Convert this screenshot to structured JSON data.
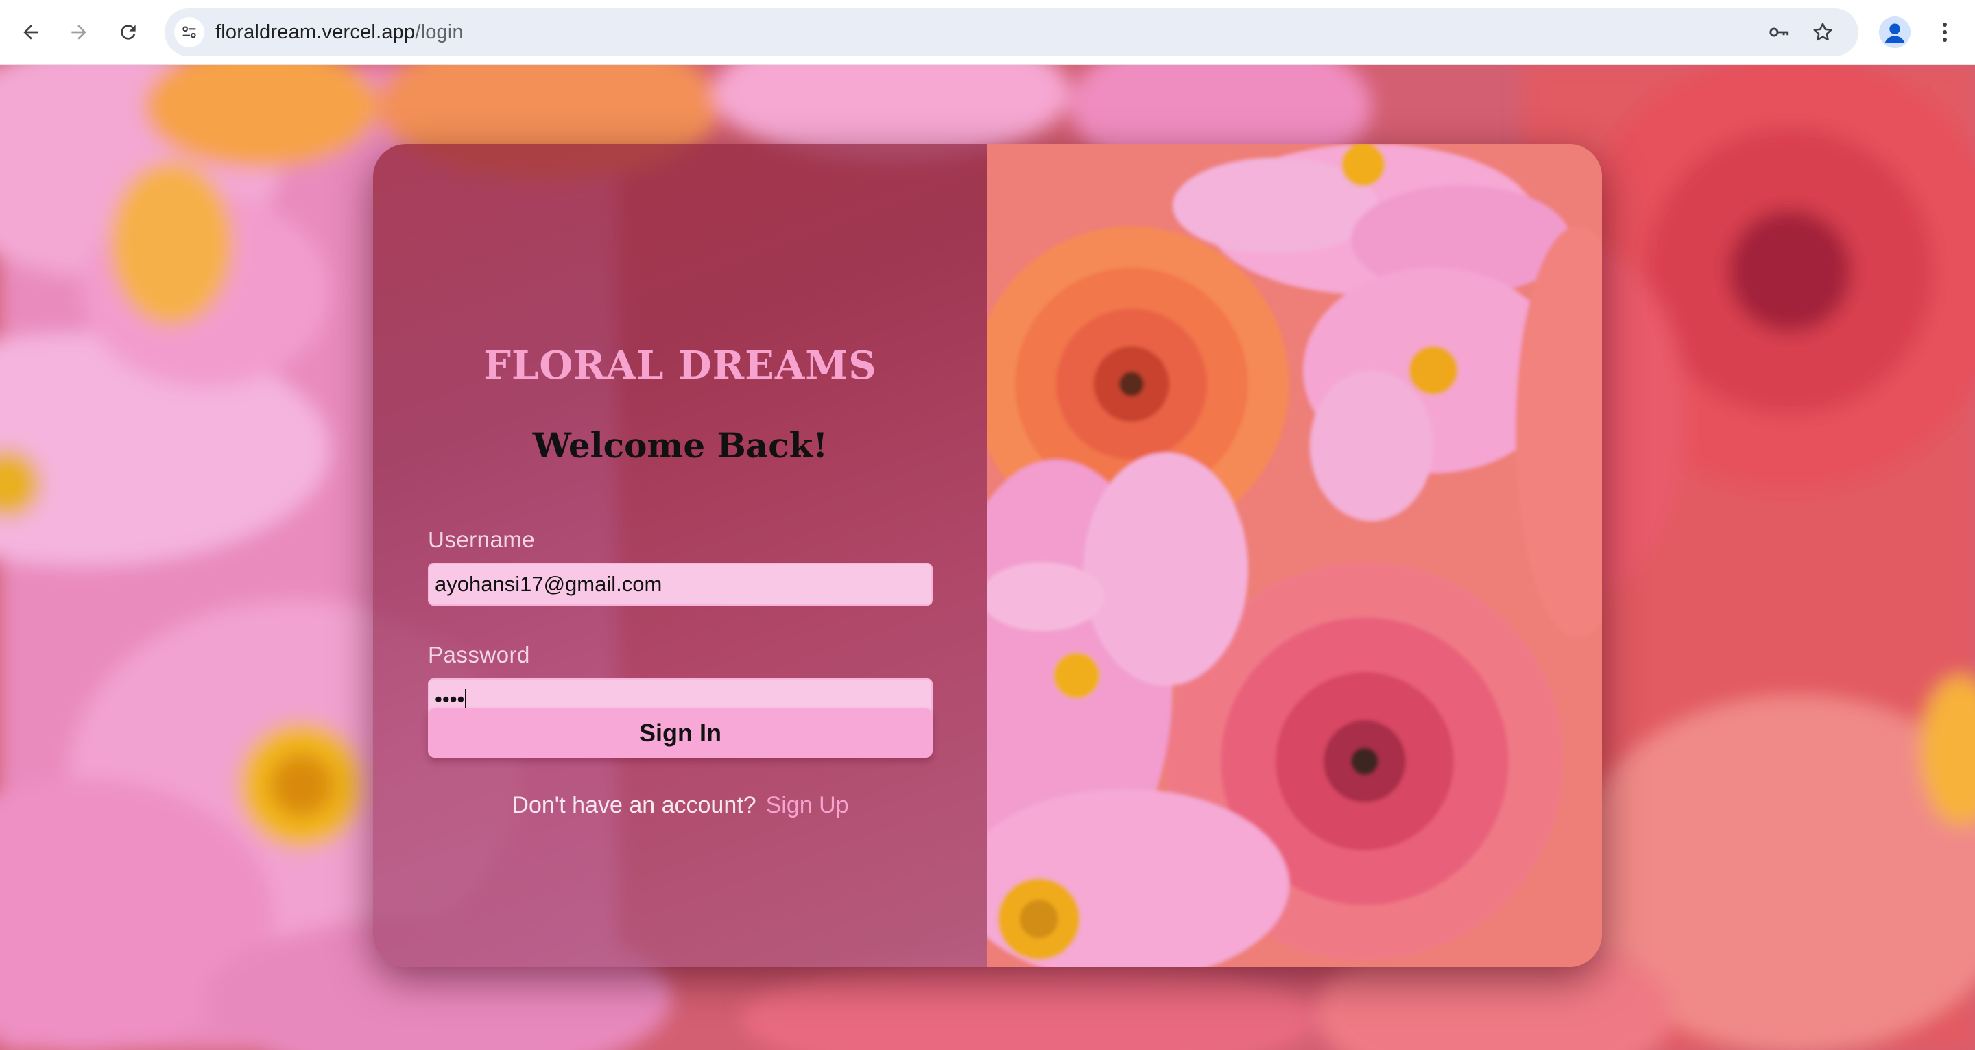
{
  "browser": {
    "url_host": "floraldream.vercel.app",
    "url_path": "/login",
    "buttons": {
      "back": "back-arrow-icon",
      "forward": "forward-arrow-icon",
      "reload": "reload-icon",
      "site_info": "tune-icon",
      "password_manager": "key-icon",
      "bookmark": "star-icon",
      "profile": "person-icon",
      "menu": "more-vert-icon"
    }
  },
  "login": {
    "brand": "FLORAL DREAMS",
    "heading": "Welcome Back!",
    "username_label": "Username",
    "username_value": "ayohansi17@gmail.com",
    "password_label": "Password",
    "password_masked": "••••",
    "signin_label": "Sign In",
    "no_account_text": "Don't have an account?",
    "signup_link": "Sign Up"
  },
  "colors": {
    "brand_pink": "#f7a3d0",
    "input_bg": "#f9c8e6",
    "button_bg": "#f8a8d6",
    "card_tint": "#8c2840"
  }
}
